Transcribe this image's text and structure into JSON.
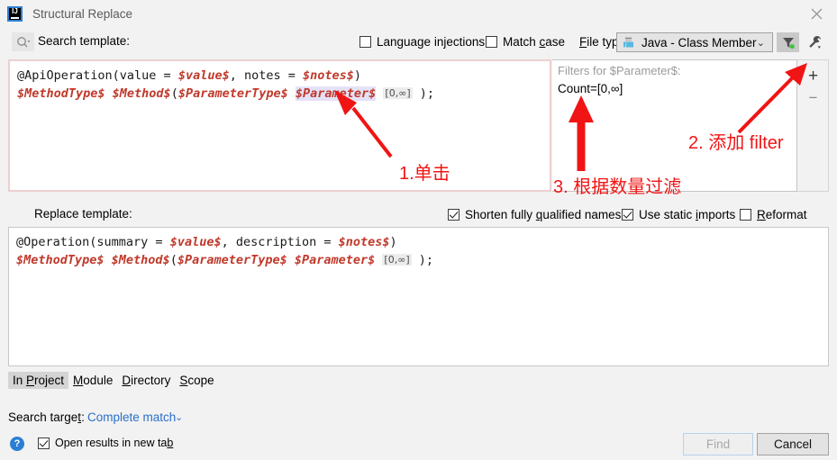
{
  "window": {
    "title": "Structural Replace",
    "logo_icon": "intellij-idea-logo-icon",
    "close_icon": "close-icon"
  },
  "search_row": {
    "search_icon": "search-dropdown-icon",
    "label": "Search template:",
    "language_injections": {
      "label": "Language injections",
      "checked": false
    },
    "match_case": {
      "label": "Match case",
      "checked": false
    },
    "file_type_label": "File type:",
    "file_type_value": "Java - Class Member",
    "file_type_icon": "java-class-member-icon",
    "file_type_caret_icon": "chevron-down-icon",
    "filter_tool_icon": "filter-icon",
    "wrench_tool_icon": "wrench-icon"
  },
  "search_template": {
    "line1": [
      {
        "text": "@ApiOperation(value = ",
        "style": "plain"
      },
      {
        "text": "$value$",
        "style": "var"
      },
      {
        "text": ", notes = ",
        "style": "plain"
      },
      {
        "text": "$notes$",
        "style": "var"
      },
      {
        "text": ")",
        "style": "plain"
      }
    ],
    "line2": [
      {
        "text": "$MethodType$ $Method$",
        "style": "var"
      },
      {
        "text": "(",
        "style": "plain"
      },
      {
        "text": "$ParameterType$ ",
        "style": "var"
      },
      {
        "text": "$Parameter$",
        "style": "var-sel"
      },
      {
        "text": " ",
        "style": "plain"
      },
      {
        "text": "[0,∞]",
        "style": "count"
      },
      {
        "text": " );",
        "style": "plain"
      }
    ]
  },
  "filters": {
    "title": "Filters for $Parameter$:",
    "items": [
      "Count=[0,∞]"
    ],
    "add_label": "+",
    "remove_label": "−"
  },
  "replace_section": {
    "label": "Replace template:",
    "shorten_fully_qualified_names": {
      "label": "Shorten fully qualified names",
      "checked": true
    },
    "use_static_imports": {
      "label": "Use static imports",
      "checked": true
    },
    "reformat": {
      "label": "Reformat",
      "checked": false
    }
  },
  "replace_template": {
    "line1": [
      {
        "text": "@Operation(summary = ",
        "style": "plain"
      },
      {
        "text": "$value$",
        "style": "var"
      },
      {
        "text": ", description = ",
        "style": "plain"
      },
      {
        "text": "$notes$",
        "style": "var"
      },
      {
        "text": ")",
        "style": "plain"
      }
    ],
    "line2": [
      {
        "text": "$MethodType$ $Method$",
        "style": "var"
      },
      {
        "text": "(",
        "style": "plain"
      },
      {
        "text": "$ParameterType$ $Parameter$",
        "style": "var"
      },
      {
        "text": " ",
        "style": "plain"
      },
      {
        "text": "[0,∞]",
        "style": "count"
      },
      {
        "text": " );",
        "style": "plain"
      }
    ]
  },
  "scope_tabs": [
    {
      "label": "In Project",
      "active": true
    },
    {
      "label": "Module",
      "active": false
    },
    {
      "label": "Directory",
      "active": false
    },
    {
      "label": "Scope",
      "active": false
    }
  ],
  "search_target": {
    "label": "Search target:",
    "value": "Complete match",
    "caret_icon": "chevron-down-icon"
  },
  "footer": {
    "help_icon": "help-icon",
    "help_glyph": "?",
    "open_results_in_new_tab": {
      "label": "Open results in new tab",
      "checked": true
    },
    "find_button": "Find",
    "cancel_button": "Cancel"
  },
  "annotations": [
    {
      "id": "anno-1",
      "text": "1.单击",
      "color": "#f01414"
    },
    {
      "id": "anno-2",
      "text": "2. 添加 filter",
      "color": "#f01414"
    },
    {
      "id": "anno-3",
      "text": "3. 根据数量过滤",
      "color": "#f01414"
    }
  ],
  "colors": {
    "accent_link": "#2a6fc9",
    "annotation_red": "#f01414",
    "variable_red": "#c0392b",
    "error_border": "#eccfcf",
    "selection": "#e4e2f7",
    "dialog_bg": "#f2f2f2"
  }
}
